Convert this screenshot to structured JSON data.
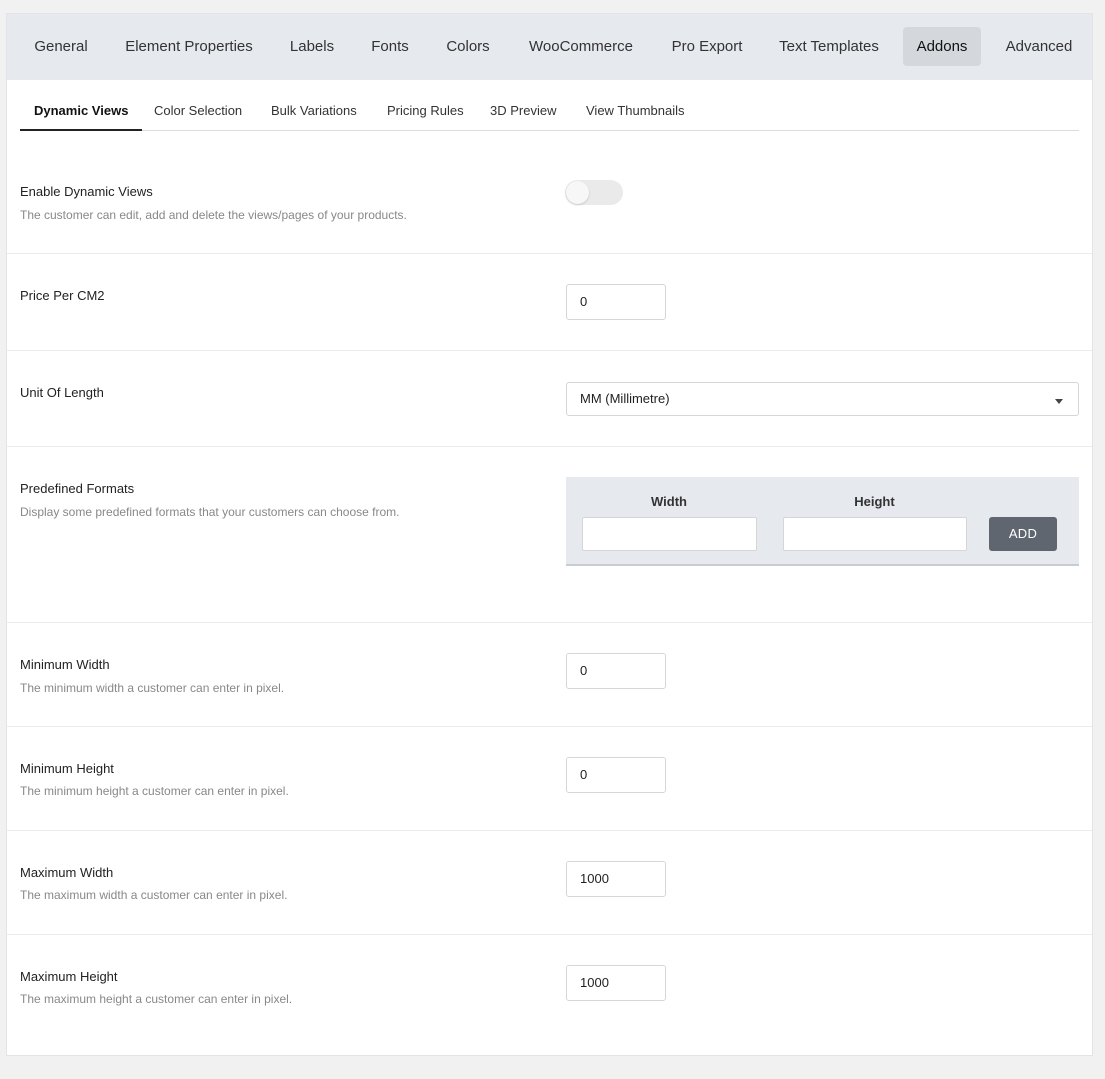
{
  "main_tabs": [
    "General",
    "Element Properties",
    "Labels",
    "Fonts",
    "Colors",
    "WooCommerce",
    "Pro Export",
    "Text Templates",
    "Addons",
    "Advanced"
  ],
  "active_main_tab": "Addons",
  "sub_tabs": [
    "Dynamic Views",
    "Color Selection",
    "Bulk Variations",
    "Pricing Rules",
    "3D Preview",
    "View Thumbnails"
  ],
  "active_sub_tab": "Dynamic Views",
  "settings": {
    "enable_dynamic_views": {
      "label": "Enable Dynamic Views",
      "description": "The customer can edit, add and delete the views/pages of your products.",
      "enabled": false
    },
    "price_per_cm2": {
      "label": "Price Per CM2",
      "value": "0"
    },
    "unit_of_length": {
      "label": "Unit Of Length",
      "value": "MM (Millimetre)"
    },
    "predefined_formats": {
      "label": "Predefined Formats",
      "description": "Display some predefined formats that your customers can choose from.",
      "width_header": "Width",
      "height_header": "Height",
      "add_label": "ADD"
    },
    "minimum_width": {
      "label": "Minimum Width",
      "description": "The minimum width a customer can enter in pixel.",
      "value": "0"
    },
    "minimum_height": {
      "label": "Minimum Height",
      "description": "The minimum height a customer can enter in pixel.",
      "value": "0"
    },
    "maximum_width": {
      "label": "Maximum Width",
      "description": "The maximum width a customer can enter in pixel.",
      "value": "1000"
    },
    "maximum_height": {
      "label": "Maximum Height",
      "description": "The maximum height a customer can enter in pixel.",
      "value": "1000"
    }
  },
  "colors": {
    "tab_bar_bg": "#e6e9ee",
    "active_tab_bg": "#d4d7dc",
    "add_button_bg": "#5f6670"
  }
}
